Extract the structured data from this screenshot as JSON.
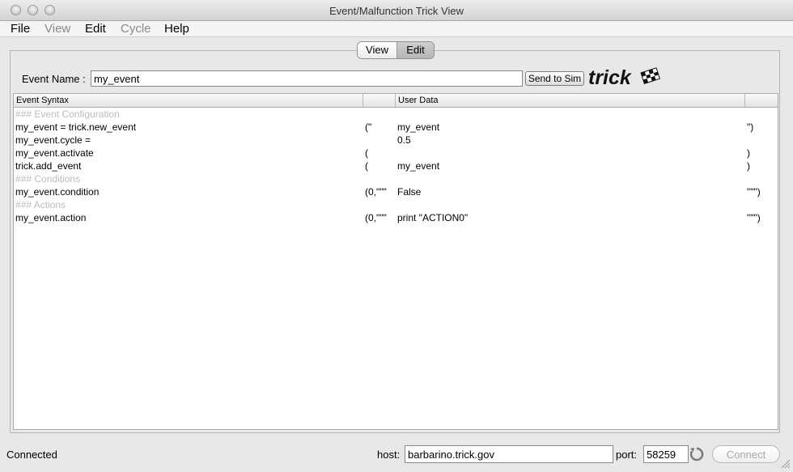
{
  "window": {
    "title": "Event/Malfunction Trick View"
  },
  "menu": {
    "file": "File",
    "view": "View",
    "edit": "Edit",
    "cycle": "Cycle",
    "help": "Help"
  },
  "mode_tabs": {
    "view": "View",
    "edit": "Edit",
    "selected": "Edit"
  },
  "event_form": {
    "label": "Event Name :",
    "value": "my_event",
    "send_button": "Send to Sim"
  },
  "logo": {
    "text": "trick"
  },
  "table": {
    "headers": {
      "syntax": "Event Syntax",
      "user_data": "User Data"
    },
    "rows": [
      {
        "syntax": "### Event Configuration",
        "open": "",
        "data": "",
        "close": "",
        "comment": true
      },
      {
        "syntax": "my_event = trick.new_event",
        "open": "(\"",
        "data": "my_event",
        "close": "\")",
        "comment": false
      },
      {
        "syntax": "my_event.cycle =",
        "open": "",
        "data": "0.5",
        "close": "",
        "comment": false
      },
      {
        "syntax": "my_event.activate",
        "open": "(",
        "data": "",
        "close": ")",
        "comment": false
      },
      {
        "syntax": "trick.add_event",
        "open": "(",
        "data": "my_event",
        "close": ")",
        "comment": false
      },
      {
        "syntax": "### Conditions",
        "open": "",
        "data": "",
        "close": "",
        "comment": true
      },
      {
        "syntax": "my_event.condition",
        "open": "(0,\"\"\"",
        "data": "False",
        "close": "\"\"\")",
        "comment": false
      },
      {
        "syntax": "### Actions",
        "open": "",
        "data": "",
        "close": "",
        "comment": true
      },
      {
        "syntax": "my_event.action",
        "open": "(0,\"\"\"",
        "data": "print \"ACTION0\"",
        "close": "\"\"\")",
        "comment": false
      }
    ]
  },
  "status": {
    "text": "Connected",
    "host_label": "host:",
    "host_value": "barbarino.trick.gov",
    "port_label": "port:",
    "port_value": "58259",
    "connect_button": "Connect"
  }
}
